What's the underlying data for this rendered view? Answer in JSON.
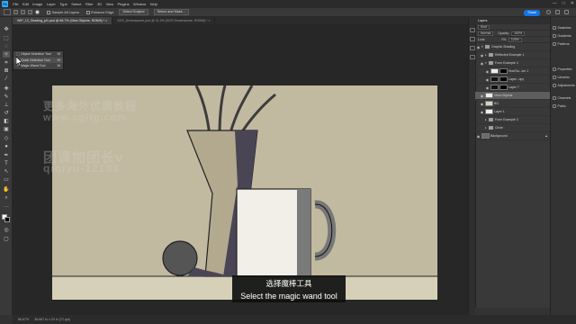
{
  "app": {
    "menu": [
      "File",
      "Edit",
      "Image",
      "Layer",
      "Type",
      "Select",
      "Filter",
      "3D",
      "View",
      "Plugins",
      "Window",
      "Help"
    ],
    "window_controls": [
      "—",
      "□",
      "✕"
    ]
  },
  "options_bar": {
    "sample_all_layers": "Sample All Layers",
    "enhance_edge": "Enhance Edge",
    "select_subject": "Select Subject",
    "select_and_mask": "Select and Mask...",
    "share": "Share"
  },
  "tabs": [
    {
      "label": "WIP_13_Shading_pt1.psd @ 66.7% (View Objects, RGB/8) *",
      "close": "×"
    },
    {
      "label": "SOS_Dreamscene.psd @ 31.2% (SOS Dreamscene, RGB/8) *",
      "close": "×"
    }
  ],
  "tool_flyout": {
    "items": [
      {
        "label": "Object Selection Tool",
        "shortcut": "W"
      },
      {
        "label": "Quick Selection Tool",
        "shortcut": "W"
      },
      {
        "label": "Magic Wand Tool",
        "shortcut": "W"
      }
    ]
  },
  "watermark": {
    "line1": "更多海外优质教程",
    "line2": "www.cgltg.com",
    "line3": "团课加团长v",
    "line4": "qiqiyu-12138"
  },
  "subtitle": {
    "zh": "选择魔棒工具",
    "en": "Select the magic wand tool"
  },
  "status": {
    "zoom": "66.67%",
    "doc": "36.667 in x 20 in (72 ppi)"
  },
  "layers_panel": {
    "title": "Layers",
    "kind": "Kind",
    "blend_mode": "Normal",
    "opacity_label": "Opacity:",
    "opacity": "100%",
    "lock_label": "Lock:",
    "fill_label": "Fill:",
    "fill": "100%",
    "layers": [
      {
        "name": "Graphic Shading",
        "type": "group",
        "indent": 0
      },
      {
        "name": "Reflected Example 1",
        "type": "group",
        "indent": 1
      },
      {
        "name": "Form Example 4",
        "type": "group",
        "indent": 1
      },
      {
        "name": "Hue/Sa...ion 1",
        "type": "adjust",
        "indent": 2
      },
      {
        "name": "Layer...opy",
        "type": "mask",
        "indent": 2
      },
      {
        "name": "Layer 7",
        "type": "mask",
        "indent": 2
      },
      {
        "name": "View Objects",
        "type": "layer",
        "indent": 1,
        "selected": true
      },
      {
        "name": "BG",
        "type": "layer",
        "indent": 1
      },
      {
        "name": "Layer 1",
        "type": "layer",
        "indent": 1
      },
      {
        "name": "Form Example 3",
        "type": "group",
        "indent": 1
      },
      {
        "name": "Circle",
        "type": "group",
        "indent": 1
      },
      {
        "name": "Background",
        "type": "layer",
        "indent": 0
      }
    ]
  },
  "properties_column": {
    "items": [
      "Swatches",
      "Gradients",
      "Patterns",
      "Properties",
      "Libraries",
      "Adjustments",
      "Channels",
      "Paths"
    ]
  },
  "colors": {
    "accent": "#31a8ff",
    "canvas_bg": "#c2b9a1",
    "ground": "#d7d0b9",
    "selected_layer": "#5e5e5e"
  }
}
